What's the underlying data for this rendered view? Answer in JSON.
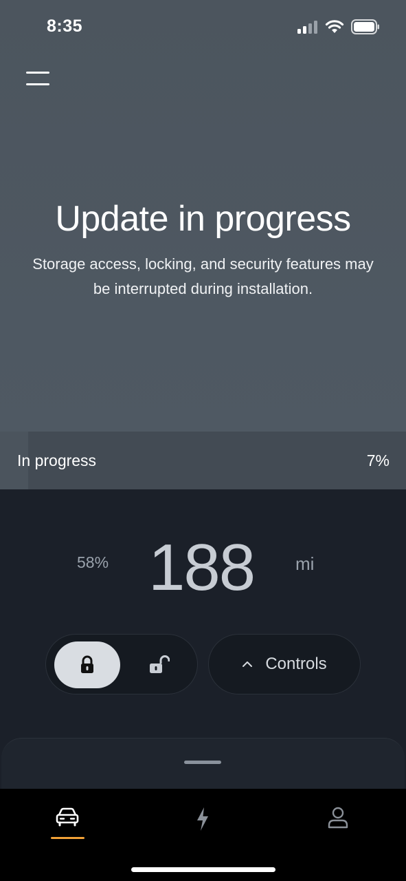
{
  "status_bar": {
    "time": "8:35"
  },
  "hero": {
    "title": "Update in progress",
    "subtitle": "Storage access, locking, and security features may be interrupted during installation."
  },
  "update": {
    "label": "In progress",
    "percent_text": "7%",
    "percent": 7
  },
  "range": {
    "battery": "58%",
    "value": "188",
    "unit": "mi"
  },
  "controls": {
    "label": "Controls",
    "lock_state": "locked"
  },
  "tabs": [
    {
      "name": "vehicle",
      "icon": "car-icon",
      "active": true
    },
    {
      "name": "charging",
      "icon": "lightning-icon",
      "active": false
    },
    {
      "name": "profile",
      "icon": "person-icon",
      "active": false
    }
  ],
  "colors": {
    "accent": "#f0a137",
    "hero_bg": "#4f5963",
    "body_bg": "#1b2029"
  }
}
